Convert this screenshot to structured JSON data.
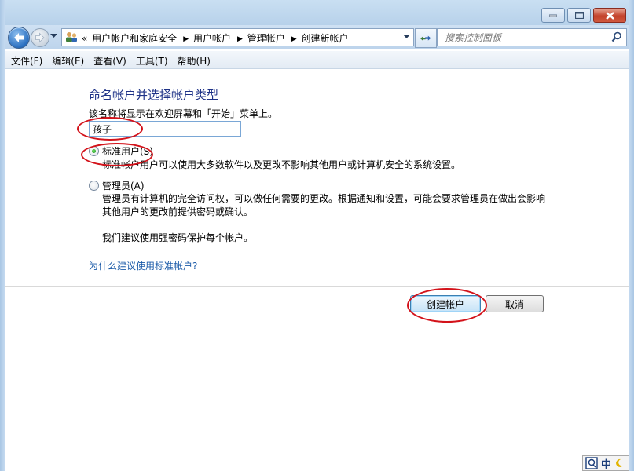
{
  "navbar": {
    "breadcrumbs": [
      "用户帐户和家庭安全",
      "用户帐户",
      "管理帐户",
      "创建新帐户"
    ],
    "overflow_marker": "«",
    "search_placeholder": "搜索控制面板"
  },
  "menubar": {
    "items": [
      "文件(F)",
      "编辑(E)",
      "查看(V)",
      "工具(T)",
      "帮助(H)"
    ]
  },
  "main": {
    "title": "命名帐户并选择帐户类型",
    "description": "该名称将显示在欢迎屏幕和「开始」菜单上。",
    "account_name_value": "孩子",
    "options": [
      {
        "label": "标准用户(S)",
        "selected": true,
        "description": [
          "标准帐户用户可以使用大多数软件以及更改不影响其他用户或计算机安全的系统设置。"
        ]
      },
      {
        "label": "管理员(A)",
        "selected": false,
        "description": [
          "管理员有计算机的完全访问权，可以做任何需要的更改。根据通知和设置，可能会要求管理员在做出会影响",
          "其他用户的更改前提供密码或确认。"
        ]
      }
    ],
    "recommendation": "我们建议使用强密码保护每个帐户。",
    "help_link": "为什么建议使用标准帐户?",
    "create_button": "创建帐户",
    "cancel_button": "取消"
  },
  "tray": {
    "ime_label": "中"
  },
  "colors": {
    "title_blue": "#1e3287",
    "link_blue": "#1a5aa8",
    "annotation_red": "#d3121a"
  }
}
